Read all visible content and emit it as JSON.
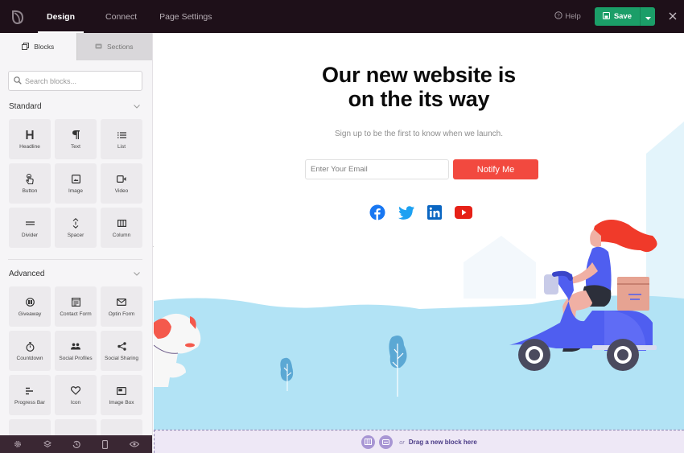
{
  "topbar": {
    "logo": "seedprod-leaf-logo",
    "tabs": [
      {
        "label": "Design",
        "active": true
      },
      {
        "label": "Connect",
        "active": false
      },
      {
        "label": "Page Settings",
        "active": false
      }
    ],
    "help_label": "Help",
    "save_label": "Save",
    "accent_color": "#1b9e68"
  },
  "sidebar": {
    "tabs": [
      {
        "label": "Blocks",
        "icon": "blocks-icon",
        "active": true
      },
      {
        "label": "Sections",
        "icon": "sections-icon",
        "active": false
      }
    ],
    "search_placeholder": "Search blocks...",
    "standard": {
      "title": "Standard",
      "items": [
        {
          "label": "Headline",
          "icon": "headline-icon"
        },
        {
          "label": "Text",
          "icon": "paragraph-icon"
        },
        {
          "label": "List",
          "icon": "list-icon"
        },
        {
          "label": "Button",
          "icon": "pointer-hand-icon"
        },
        {
          "label": "Image",
          "icon": "image-icon"
        },
        {
          "label": "Video",
          "icon": "video-icon"
        },
        {
          "label": "Divider",
          "icon": "divider-icon"
        },
        {
          "label": "Spacer",
          "icon": "spacer-icon"
        },
        {
          "label": "Column",
          "icon": "column-icon"
        }
      ]
    },
    "advanced": {
      "title": "Advanced",
      "items": [
        {
          "label": "Giveaway",
          "icon": "giveaway-icon"
        },
        {
          "label": "Contact Form",
          "icon": "contact-form-icon"
        },
        {
          "label": "Optin Form",
          "icon": "envelope-icon"
        },
        {
          "label": "Countdown",
          "icon": "stopwatch-icon"
        },
        {
          "label": "Social Profiles",
          "icon": "users-icon"
        },
        {
          "label": "Social Sharing",
          "icon": "share-icon"
        },
        {
          "label": "Progress Bar",
          "icon": "progress-bar-icon"
        },
        {
          "label": "Icon",
          "icon": "heart-icon"
        },
        {
          "label": "Image Box",
          "icon": "image-box-icon"
        }
      ]
    },
    "bottom_bar": [
      "settings-icon",
      "layers-icon",
      "history-icon",
      "mobile-icon",
      "preview-icon"
    ]
  },
  "canvas": {
    "headline_line1": "Our new website is",
    "headline_line2": "on the its way",
    "subtext": "Sign up to be the first to know when we launch.",
    "email_placeholder": "Enter Your Email",
    "notify_label": "Notify Me",
    "notify_color": "#f2493f",
    "socials": [
      {
        "name": "facebook",
        "color": "#1877f2"
      },
      {
        "name": "twitter",
        "color": "#1da1f2"
      },
      {
        "name": "linkedin",
        "color": "#0a66c2"
      },
      {
        "name": "youtube",
        "color": "#e62117"
      }
    ],
    "dropzone": {
      "or_label": "or",
      "drag_label": "Drag a new block here"
    }
  }
}
